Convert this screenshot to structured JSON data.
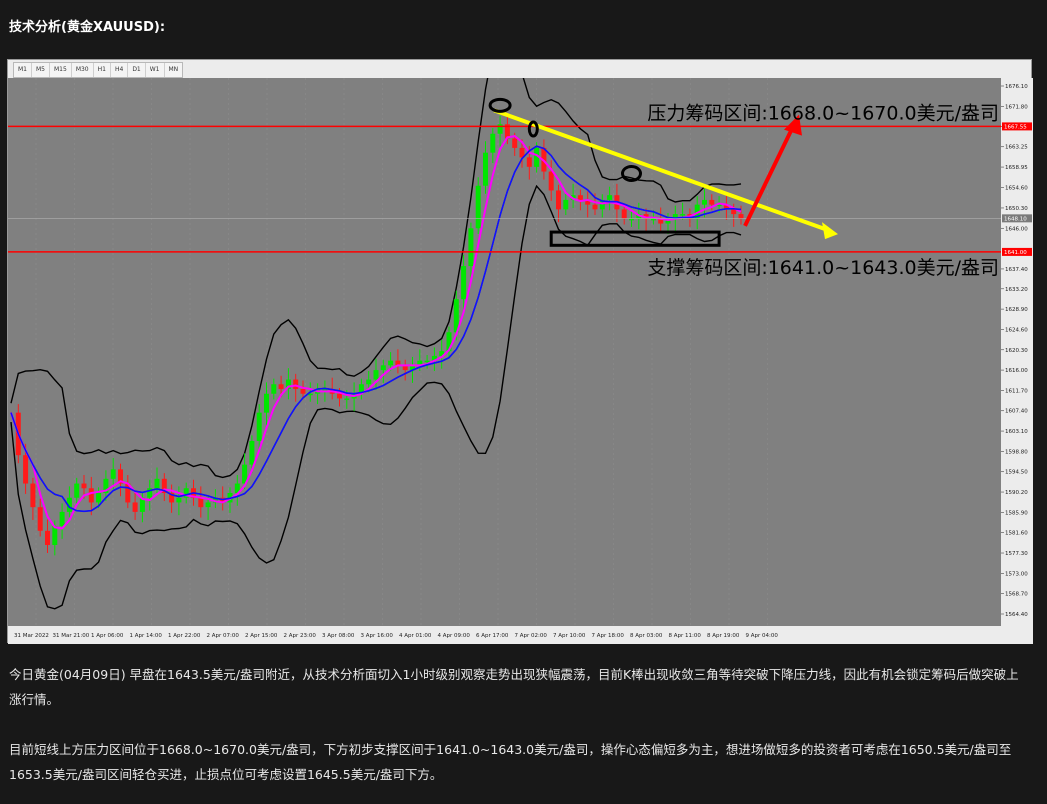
{
  "heading": "技术分析(黄金XAUUSD):",
  "timeframes": [
    "M1",
    "M5",
    "M15",
    "M30",
    "H1",
    "H4",
    "D1",
    "W1",
    "MN"
  ],
  "chart_data": {
    "type": "candlestick",
    "price_axis": {
      "ticks": [
        "1676.10",
        "1671.80",
        "1667.55",
        "1663.25",
        "1658.95",
        "1654.60",
        "1650.30",
        "1646.00",
        "1637.40",
        "1633.20",
        "1628.90",
        "1624.60",
        "1620.30",
        "1616.00",
        "1611.70",
        "1607.40",
        "1603.10",
        "1598.80",
        "1594.50",
        "1590.20",
        "1585.90",
        "1581.60",
        "1577.30",
        "1573.00",
        "1568.70",
        "1564.40"
      ],
      "range": [
        1564.4,
        1676.1
      ]
    },
    "time_axis": {
      "ticks": [
        "31 Mar 2022",
        "31 Mar 21:00",
        "1 Apr 06:00",
        "1 Apr 14:00",
        "1 Apr 22:00",
        "2 Apr 07:00",
        "2 Apr 15:00",
        "2 Apr 23:00",
        "3 Apr 08:00",
        "3 Apr 16:00",
        "4 Apr 01:00",
        "4 Apr 09:00",
        "6 Apr 17:00",
        "7 Apr 02:00",
        "7 Apr 10:00",
        "7 Apr 18:00",
        "8 Apr 03:00",
        "8 Apr 11:00",
        "8 Apr 19:00",
        "9 Apr 04:00"
      ]
    },
    "price_tags": {
      "resistance": "1667.55",
      "current": "1648.10",
      "support": "1641.00"
    },
    "levels": {
      "resistance": 1667.55,
      "support": 1641.0,
      "current": 1648.1
    },
    "annotations": {
      "resistance_label": "压力筹码区间:1668.0~1670.0美元/盎司",
      "support_label": "支撑筹码区间:1641.0~1643.0美元/盎司"
    },
    "colors": {
      "up_candle": "#00e600",
      "down_candle": "#ff1a1a",
      "ma_fast": "#ff00ff",
      "ma_slow": "#1010ff",
      "bands": "#000000",
      "level_lines": "#ff0000",
      "trend_line": "#ffff00",
      "breakout_arrow": "#ff0000"
    },
    "close_series": [
      1607,
      1598,
      1592,
      1587,
      1582,
      1579,
      1583,
      1586,
      1589,
      1592,
      1591,
      1588,
      1590,
      1593,
      1595,
      1592,
      1588,
      1586,
      1589,
      1591,
      1593,
      1590,
      1588,
      1589,
      1591,
      1589,
      1587,
      1588,
      1589,
      1588,
      1590,
      1592,
      1596,
      1601,
      1607,
      1611,
      1613,
      1612,
      1614,
      1612,
      1611,
      1611,
      1612,
      1612,
      1611,
      1610,
      1610,
      1611,
      1613,
      1614,
      1616,
      1617,
      1618,
      1617,
      1616,
      1617,
      1618,
      1618,
      1619,
      1620,
      1624,
      1631,
      1638,
      1646,
      1655,
      1662,
      1666,
      1668,
      1665,
      1663,
      1661,
      1659,
      1663,
      1658,
      1654,
      1650,
      1652,
      1653,
      1652,
      1651,
      1650,
      1652,
      1653,
      1650,
      1648,
      1648,
      1649,
      1648,
      1648,
      1647,
      1648,
      1649,
      1649,
      1648,
      1651,
      1652,
      1651,
      1651,
      1650,
      1649,
      1648
    ]
  },
  "paragraph1": "今日黄金(04月09日) 早盘在1643.5美元/盎司附近，从技术分析面切入1小时级别观察走势出现狭幅震荡，目前K棒出现收敛三角等待突破下降压力线，因此有机会锁定筹码后做突破上涨行情。",
  "paragraph2": "目前短线上方压力区间位于1668.0~1670.0美元/盎司，下方初步支撑区间于1641.0~1643.0美元/盎司，操作心态偏短多为主，想进场做短多的投资者可考虑在1650.5美元/盎司至1653.5美元/盎司区间轻仓买进，止损点位可考虑设置1645.5美元/盎司下方。"
}
